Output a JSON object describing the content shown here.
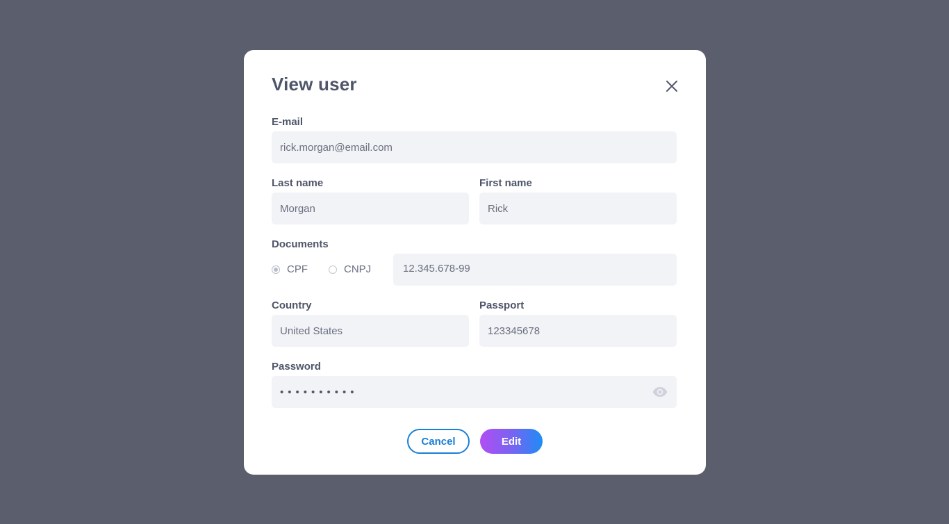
{
  "modal": {
    "title": "View user",
    "close_icon": "close-icon"
  },
  "form": {
    "email": {
      "label": "E-mail",
      "value": "rick.morgan@email.com"
    },
    "last_name": {
      "label": "Last name",
      "value": "Morgan"
    },
    "first_name": {
      "label": "First name",
      "value": "Rick"
    },
    "documents": {
      "label": "Documents",
      "options": [
        {
          "label": "CPF",
          "selected": true
        },
        {
          "label": "CNPJ",
          "selected": false
        }
      ],
      "value": "12.345.678-99"
    },
    "country": {
      "label": "Country",
      "value": "United States"
    },
    "passport": {
      "label": "Passport",
      "value": "123345678"
    },
    "password": {
      "label": "Password",
      "masked_value": "••••••••••",
      "toggle_icon": "eye-icon"
    }
  },
  "actions": {
    "cancel_label": "Cancel",
    "edit_label": "Edit"
  },
  "colors": {
    "backdrop": "#5b5e6d",
    "text": "#4f5569",
    "field_bg": "#f2f3f6",
    "primary": "#1a7fd6",
    "gradient_start": "#b14ef3",
    "gradient_end": "#1f8cf6"
  }
}
